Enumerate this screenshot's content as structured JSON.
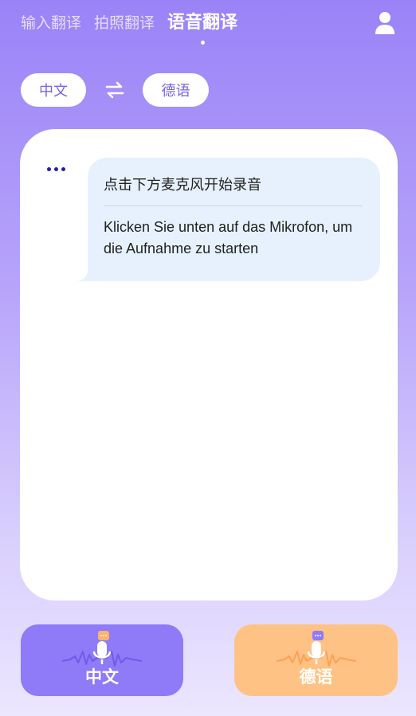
{
  "tabs": [
    {
      "label": "输入翻译",
      "active": false
    },
    {
      "label": "拍照翻译",
      "active": false
    },
    {
      "label": "语音翻译",
      "active": true
    }
  ],
  "icons": {
    "user": "user-icon",
    "swap": "swap-arrows-icon",
    "more": "more-dots-icon",
    "mic": "microphone-icon"
  },
  "languages": {
    "source": "中文",
    "target": "德语"
  },
  "conversation": {
    "source_text": "点击下方麦克风开始录音",
    "translated_text": "Klicken Sie unten auf das Mikrofon, um die Aufnahme zu starten"
  },
  "buttons": {
    "left_label": "中文",
    "right_label": "德语"
  },
  "colors": {
    "accent": "#8f7af8",
    "accent_text": "#7a63e6",
    "orange": "#ffc285",
    "bubble": "#e6f1fd",
    "dots": "#2a1aa8"
  }
}
